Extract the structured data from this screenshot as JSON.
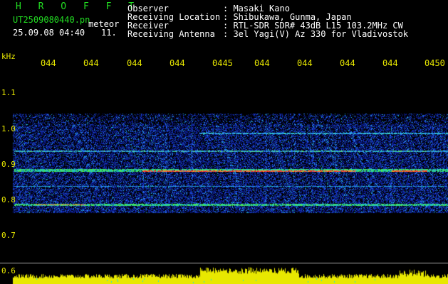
{
  "header": {
    "program": "H R O F F T",
    "filename": "UT2509080440.pn",
    "label": "meteor",
    "datetime": "25.09.08 04:40",
    "counter": "11.",
    "fields": [
      {
        "key": "Observer",
        "value": ": Masaki Kano"
      },
      {
        "key": "Receiving Location",
        "value": ": Shibukawa, Gunma, Japan"
      },
      {
        "key": "Receiver",
        "value": ": RTL-SDR SDR# 43dB L15 103.2MHz CW"
      },
      {
        "key": "Receiving Antenna",
        "value": ": 3el Yagi(V) Az 330 for Vladivostok"
      }
    ]
  },
  "axis": {
    "unit": "kHz",
    "time_ticks": [
      "044",
      "044",
      "044",
      "044",
      "0445",
      "044",
      "044",
      "044",
      "044",
      "0450"
    ],
    "freq_ticks": [
      "1.1",
      "1.0",
      "0.9",
      "0.8",
      "0.7",
      "0.6"
    ]
  },
  "colors": {
    "label_yellow": "#e8e800",
    "title_green": "#22dd22",
    "noise_blue": "#1a3dd6",
    "signal_red": "#ff2020"
  }
}
